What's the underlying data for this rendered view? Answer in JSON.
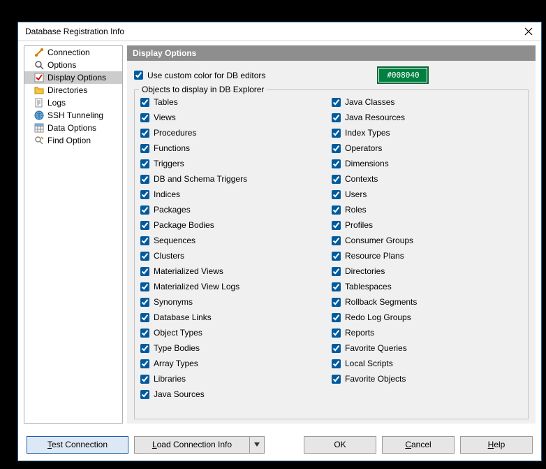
{
  "window": {
    "title": "Database Registration Info"
  },
  "sidebar": {
    "items": [
      {
        "label": "Connection",
        "icon": "link-icon"
      },
      {
        "label": "Options",
        "icon": "magnify-icon"
      },
      {
        "label": "Display Options",
        "icon": "checkbox-icon"
      },
      {
        "label": "Directories",
        "icon": "folder-icon"
      },
      {
        "label": "Logs",
        "icon": "doc-icon"
      },
      {
        "label": "SSH Tunneling",
        "icon": "globe-icon"
      },
      {
        "label": "Data Options",
        "icon": "grid-icon"
      },
      {
        "label": "Find Option",
        "icon": "find-icon"
      }
    ],
    "selected_index": 2
  },
  "header": {
    "title": "Display Options"
  },
  "custom_color": {
    "label": "Use custom color for DB editors",
    "checked": true,
    "value": "#008040"
  },
  "objects": {
    "legend": "Objects to display in DB Explorer",
    "left": [
      {
        "label": "Tables",
        "checked": true
      },
      {
        "label": "Views",
        "checked": true
      },
      {
        "label": "Procedures",
        "checked": true
      },
      {
        "label": "Functions",
        "checked": true
      },
      {
        "label": "Triggers",
        "checked": true
      },
      {
        "label": "DB and Schema Triggers",
        "checked": true
      },
      {
        "label": "Indices",
        "checked": true
      },
      {
        "label": "Packages",
        "checked": true
      },
      {
        "label": "Package Bodies",
        "checked": true
      },
      {
        "label": "Sequences",
        "checked": true
      },
      {
        "label": "Clusters",
        "checked": true
      },
      {
        "label": "Materialized Views",
        "checked": true
      },
      {
        "label": "Materialized View Logs",
        "checked": true
      },
      {
        "label": "Synonyms",
        "checked": true
      },
      {
        "label": "Database Links",
        "checked": true
      },
      {
        "label": "Object Types",
        "checked": true
      },
      {
        "label": "Type Bodies",
        "checked": true
      },
      {
        "label": "Array Types",
        "checked": true
      },
      {
        "label": "Libraries",
        "checked": true
      },
      {
        "label": "Java Sources",
        "checked": true
      }
    ],
    "right": [
      {
        "label": "Java Classes",
        "checked": true
      },
      {
        "label": "Java Resources",
        "checked": true
      },
      {
        "label": "Index Types",
        "checked": true
      },
      {
        "label": "Operators",
        "checked": true
      },
      {
        "label": "Dimensions",
        "checked": true
      },
      {
        "label": "Contexts",
        "checked": true
      },
      {
        "label": "Users",
        "checked": true
      },
      {
        "label": "Roles",
        "checked": true
      },
      {
        "label": "Profiles",
        "checked": true
      },
      {
        "label": "Consumer Groups",
        "checked": true
      },
      {
        "label": "Resource Plans",
        "checked": true
      },
      {
        "label": "Directories",
        "checked": true
      },
      {
        "label": "Tablespaces",
        "checked": true
      },
      {
        "label": "Rollback Segments",
        "checked": true
      },
      {
        "label": "Redo Log Groups",
        "checked": true
      },
      {
        "label": "Reports",
        "checked": true
      },
      {
        "label": "Favorite Queries",
        "checked": true
      },
      {
        "label": "Local Scripts",
        "checked": true
      },
      {
        "label": "Favorite Objects",
        "checked": true
      }
    ]
  },
  "buttons": {
    "test": "Test Connection",
    "load": "Load Connection Info",
    "ok": "OK",
    "cancel": "Cancel",
    "help": "Help"
  }
}
